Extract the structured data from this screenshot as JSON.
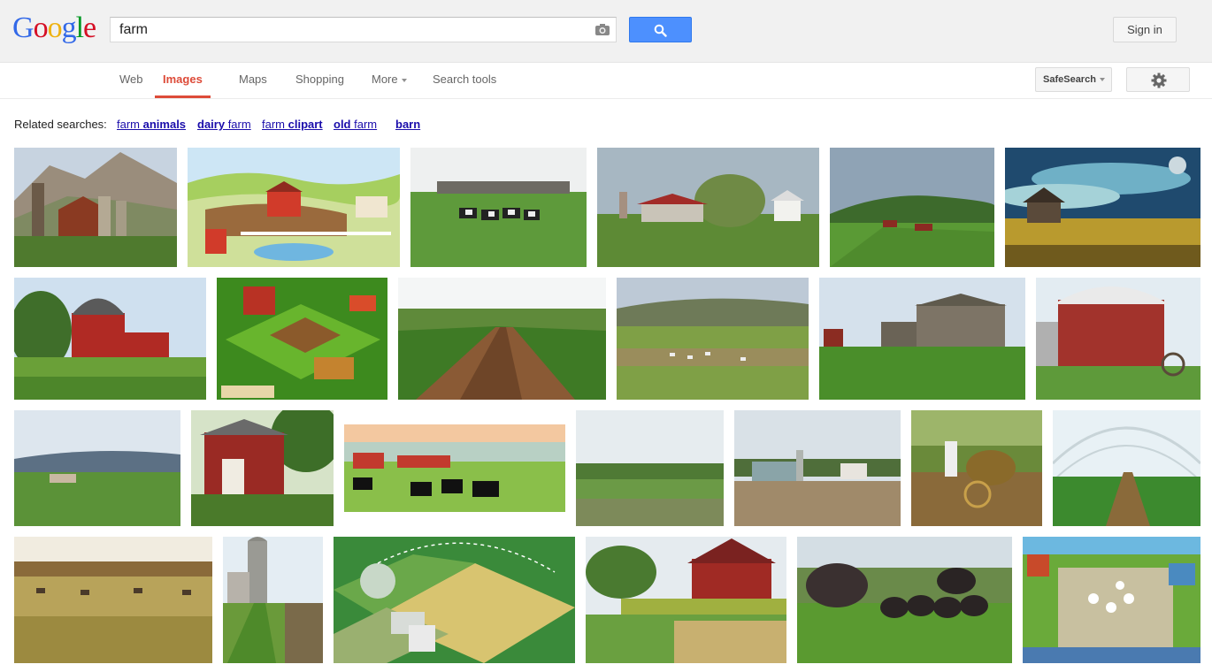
{
  "header": {
    "logo_letters": [
      {
        "ch": "G",
        "color": "#3369e8"
      },
      {
        "ch": "o",
        "color": "#d50f25"
      },
      {
        "ch": "o",
        "color": "#eeb211"
      },
      {
        "ch": "g",
        "color": "#3369e8"
      },
      {
        "ch": "l",
        "color": "#009925"
      },
      {
        "ch": "e",
        "color": "#d50f25"
      }
    ],
    "search_value": "farm",
    "signin_label": "Sign in"
  },
  "nav": {
    "items": [
      {
        "label": "Web",
        "active": false
      },
      {
        "label": "Images",
        "active": true
      },
      {
        "label": "Maps",
        "active": false
      },
      {
        "label": "Shopping",
        "active": false
      },
      {
        "label": "More",
        "active": false
      },
      {
        "label": "Search tools",
        "active": false
      }
    ],
    "safesearch_label": "SafeSearch"
  },
  "related": {
    "label": "Related searches:",
    "links": [
      {
        "pre": "farm ",
        "bold": "animals"
      },
      {
        "pre": "",
        "bold": "dairy",
        "post": " farm"
      },
      {
        "pre": "farm ",
        "bold": "clipart"
      },
      {
        "pre": "",
        "bold": "old",
        "post": " farm"
      },
      {
        "pre": "",
        "bold": "barn"
      }
    ]
  },
  "images": [
    {
      "name": "barn-mountains"
    },
    {
      "name": "cartoon-farm"
    },
    {
      "name": "cows-grazing"
    },
    {
      "name": "red-farmhouse"
    },
    {
      "name": "green-valley"
    },
    {
      "name": "old-house-sky"
    },
    {
      "name": "red-barn-corn"
    },
    {
      "name": "farm-game"
    },
    {
      "name": "plowed-rows"
    },
    {
      "name": "pasture-animals"
    },
    {
      "name": "grey-barn"
    },
    {
      "name": "red-barn-wagon"
    },
    {
      "name": "meadow-hills"
    },
    {
      "name": "barn-garden"
    },
    {
      "name": "cow-painting"
    },
    {
      "name": "field-rows"
    },
    {
      "name": "dairy-silos"
    },
    {
      "name": "farmer-wheelbarrow"
    },
    {
      "name": "greenhouse"
    },
    {
      "name": "cattle-pasture"
    },
    {
      "name": "silo-path"
    },
    {
      "name": "precision-farm-diagram"
    },
    {
      "name": "barn-cornfield"
    },
    {
      "name": "black-pigs"
    },
    {
      "name": "farm-frenzy-game"
    }
  ],
  "colors": {
    "accent_red": "#dd4b39",
    "search_blue": "#4d90fe",
    "link_blue": "#1a0dab"
  }
}
